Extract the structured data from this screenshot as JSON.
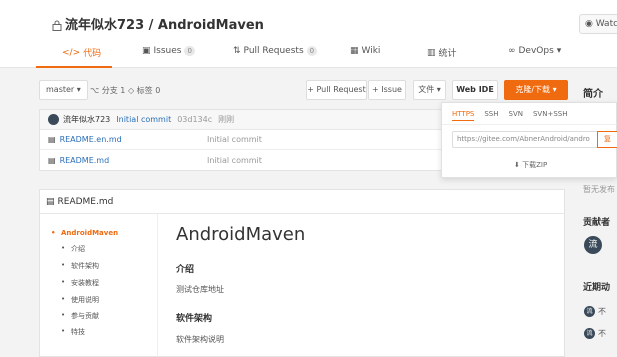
{
  "header": {
    "repo_title": "流年似水723 / AndroidMaven",
    "watch_label": "Watc",
    "tabs": [
      {
        "label": "代码",
        "icon": "code-icon"
      },
      {
        "label": "Issues",
        "badge": "0",
        "icon": "issues-icon"
      },
      {
        "label": "Pull Requests",
        "badge": "0",
        "icon": "pull-request-icon"
      },
      {
        "label": "Wiki",
        "icon": "wiki-icon"
      },
      {
        "label": "统计",
        "icon": "stats-icon"
      },
      {
        "label": "DevOps",
        "icon": "devops-icon"
      }
    ],
    "accent_color": "#f06a0f"
  },
  "toolbar": {
    "branch": "master",
    "branch_info": "分支 1",
    "tag_info": "标签 0",
    "pull_request_label": "+ Pull Request",
    "issue_label": "+ Issue",
    "file_label": "文件",
    "webide_label": "Web IDE",
    "clone_label": "克隆/下载"
  },
  "commit": {
    "author": "流年似水723",
    "message": "Initial commit",
    "hash": "03d134c",
    "time": "刚刚"
  },
  "files": [
    {
      "name": "README.en.md",
      "commit": "Initial commit"
    },
    {
      "name": "README.md",
      "commit": "Initial commit"
    }
  ],
  "clone_panel": {
    "protocols": [
      "HTTPS",
      "SSH",
      "SVN",
      "SVN+SSH"
    ],
    "active_protocol": "HTTPS",
    "url": "https://gitee.com/AbnerAndroid/andro",
    "copy_label": "复",
    "download_label": "下载ZIP"
  },
  "readme": {
    "filename": "README.md",
    "toc": [
      "AndroidMaven",
      "介绍",
      "软件架构",
      "安装教程",
      "使用说明",
      "参与贡献",
      "特技"
    ],
    "title": "AndroidMaven",
    "sections": [
      {
        "heading": "介绍",
        "body": "测试仓库地址"
      },
      {
        "heading": "软件架构",
        "body": "软件架构说明"
      }
    ]
  },
  "sidebar": {
    "title": "简介",
    "no_desc": "暂无发布",
    "contributors_title": "贡献者",
    "contributor_initial": "流",
    "activity_title": "近期动",
    "activities": [
      {
        "initial": "流",
        "text": "不"
      },
      {
        "initial": "流",
        "text": "不"
      }
    ]
  }
}
